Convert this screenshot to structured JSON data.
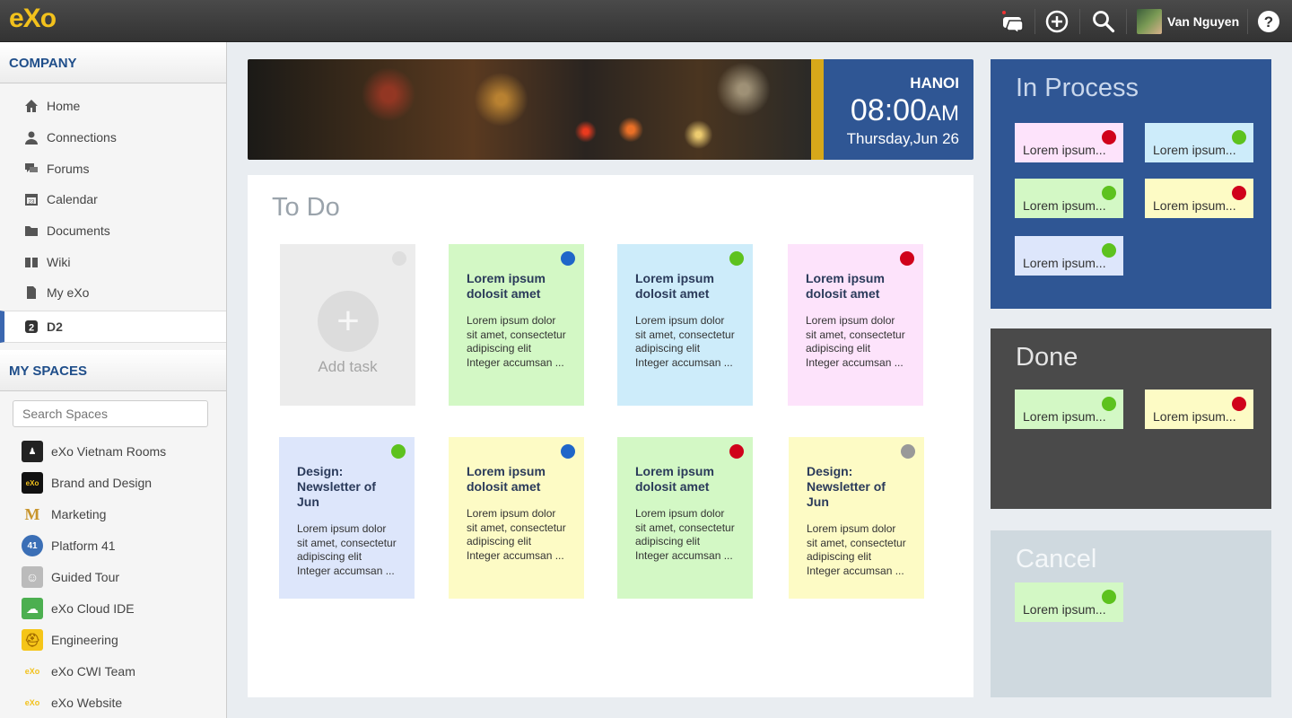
{
  "topbar": {
    "logo": "eXo",
    "user_name": "Van Nguyen",
    "icons": [
      "chat-icon",
      "add-icon",
      "search-icon",
      "help-icon"
    ]
  },
  "sidebar": {
    "company_title": "COMPANY",
    "nav": [
      {
        "label": "Home",
        "icon": "home-icon"
      },
      {
        "label": "Connections",
        "icon": "person-icon"
      },
      {
        "label": "Forums",
        "icon": "forum-icon"
      },
      {
        "label": "Calendar",
        "icon": "calendar-icon"
      },
      {
        "label": "Documents",
        "icon": "folder-icon"
      },
      {
        "label": "Wiki",
        "icon": "book-icon"
      },
      {
        "label": "My eXo",
        "icon": "document-icon"
      },
      {
        "label": "D2",
        "icon": "d2-icon"
      }
    ],
    "spaces_title": "MY SPACES",
    "search_placeholder": "Search Spaces",
    "spaces": [
      {
        "label": "eXo Vietnam Rooms",
        "color": "#222222",
        "glyph": "♟"
      },
      {
        "label": "Brand and Design",
        "color": "#111111",
        "glyph": "eXo"
      },
      {
        "label": "Marketing",
        "color": "#f5f5f5",
        "glyph": "M"
      },
      {
        "label": "Platform 41",
        "color": "#3b6fb6",
        "glyph": "41"
      },
      {
        "label": "Guided Tour",
        "color": "#bbbbbb",
        "glyph": "☺"
      },
      {
        "label": "eXo Cloud IDE",
        "color": "#4caf50",
        "glyph": "☁"
      },
      {
        "label": "Engineering",
        "color": "#f5c518",
        "glyph": "⛑"
      },
      {
        "label": "eXo CWI Team",
        "color": "#f5f5f5",
        "glyph": "eXo"
      },
      {
        "label": "eXo Website",
        "color": "#f5f5f5",
        "glyph": "eXo"
      }
    ]
  },
  "banner": {
    "city": "HANOI",
    "time": "08:00",
    "ampm": "AM",
    "date": "Thursday,Jun 26"
  },
  "todo": {
    "title": "To Do",
    "add_label": "Add task",
    "add_symbol": "+",
    "cards": [
      {
        "title": "Lorem ipsum dolosit amet",
        "body": "Lorem ipsum dolor sit amet, consectetur adipiscing elit Integer accumsan ...",
        "color": "#d3f8c5",
        "dot": "#1f66c9"
      },
      {
        "title": "Lorem ipsum dolosit amet",
        "body": "Lorem ipsum dolor sit amet, consectetur adipiscing elit Integer accumsan ...",
        "color": "#cdecfa",
        "dot": "#5dc21e"
      },
      {
        "title": "Lorem ipsum dolosit amet",
        "body": "Lorem ipsum dolor sit amet, consectetur adipiscing elit Integer accumsan ...",
        "color": "#fde3fb",
        "dot": "#d0021b"
      },
      {
        "title": "Design: Newsletter of Jun",
        "body": "Lorem ipsum dolor sit amet, consectetur adipiscing elit Integer accumsan ...",
        "color": "#dde6fb",
        "dot": "#5dc21e"
      },
      {
        "title": "Lorem ipsum dolosit amet",
        "body": "Lorem ipsum dolor sit amet, consectetur adipiscing elit Integer accumsan ...",
        "color": "#fdfbc5",
        "dot": "#1f66c9"
      },
      {
        "title": "Lorem ipsum dolosit amet",
        "body": "Lorem ipsum dolor sit amet, consectetur adipiscing elit Integer accumsan ...",
        "color": "#d3f8c5",
        "dot": "#d0021b"
      },
      {
        "title": "Design: Newsletter of Jun",
        "body": "Lorem ipsum dolor sit amet, consectetur adipiscing elit Integer accumsan ...",
        "color": "#fdfbc5",
        "dot": "#999999"
      }
    ]
  },
  "in_process": {
    "title": "In Process",
    "color": "#2f5694",
    "items": [
      {
        "label": "Lorem ipsum...",
        "color": "#fde3fb",
        "dot": "#d0021b"
      },
      {
        "label": "Lorem ipsum...",
        "color": "#cdecfa",
        "dot": "#5dc21e"
      },
      {
        "label": "Lorem ipsum...",
        "color": "#d3f8c5",
        "dot": "#5dc21e"
      },
      {
        "label": "Lorem ipsum...",
        "color": "#fdfbc5",
        "dot": "#d0021b"
      },
      {
        "label": "Lorem ipsum...",
        "color": "#dde6fb",
        "dot": "#5dc21e"
      }
    ]
  },
  "done": {
    "title": "Done",
    "color": "#4a4a4a",
    "items": [
      {
        "label": "Lorem ipsum...",
        "color": "#d3f8c5",
        "dot": "#5dc21e"
      },
      {
        "label": "Lorem ipsum...",
        "color": "#fdfbc5",
        "dot": "#d0021b"
      }
    ]
  },
  "cancel": {
    "title": "Cancel",
    "color": "#cfd9df",
    "items": [
      {
        "label": "Lorem ipsum...",
        "color": "#d3f8c5",
        "dot": "#5dc21e"
      }
    ]
  }
}
